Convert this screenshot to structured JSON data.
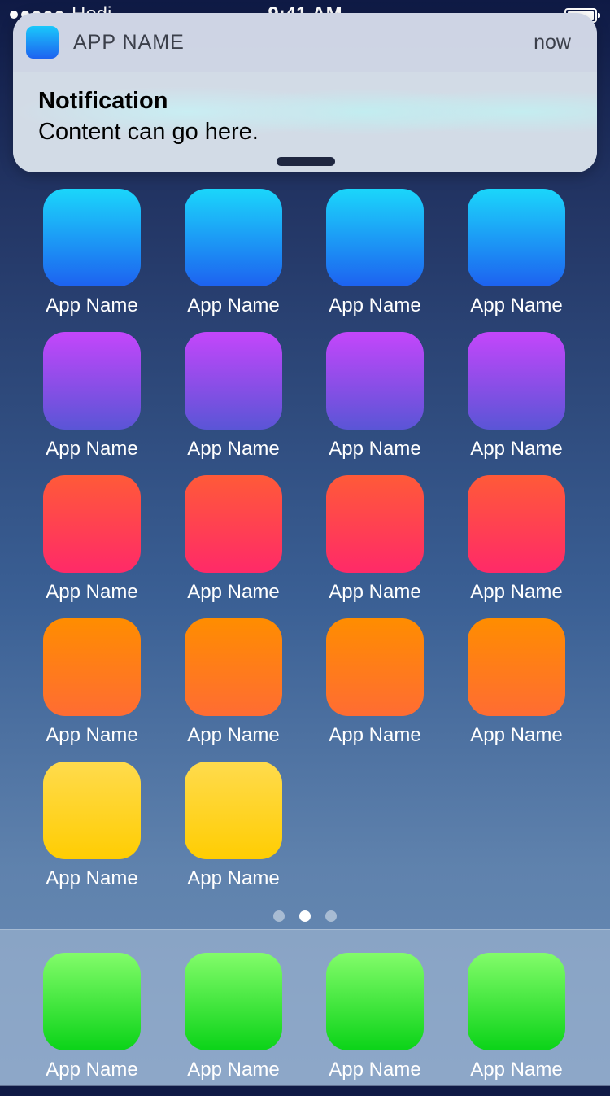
{
  "status_bar": {
    "carrier": "Hodi",
    "time": "9:41 AM"
  },
  "notification": {
    "app_name": "APP NAME",
    "time": "now",
    "title": "Notification",
    "content": "Content can go here."
  },
  "home": {
    "rows": [
      {
        "color": "blue",
        "apps": [
          "App Name",
          "App Name",
          "App Name",
          "App Name"
        ]
      },
      {
        "color": "purple",
        "apps": [
          "App Name",
          "App Name",
          "App Name",
          "App Name"
        ]
      },
      {
        "color": "red",
        "apps": [
          "App Name",
          "App Name",
          "App Name",
          "App Name"
        ]
      },
      {
        "color": "orange",
        "apps": [
          "App Name",
          "App Name",
          "App Name",
          "App Name"
        ]
      },
      {
        "color": "yellow",
        "apps": [
          "App Name",
          "App Name"
        ]
      }
    ]
  },
  "page_indicator": {
    "count": 3,
    "active": 2
  },
  "dock": {
    "color": "green",
    "apps": [
      "App Name",
      "App Name",
      "App Name",
      "App Name"
    ]
  },
  "colors": {
    "blue": "#1d62f0",
    "purple": "#c446fb",
    "red": "#ff2a68",
    "orange": "#ff8d00",
    "yellow": "#ffcd02",
    "green": "#0bd318"
  }
}
